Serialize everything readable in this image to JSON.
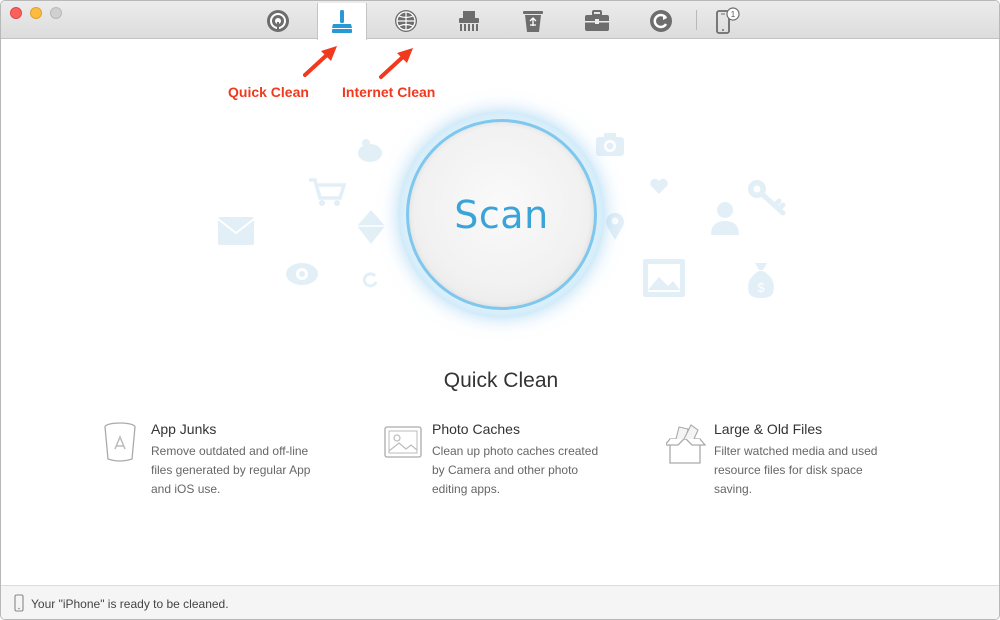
{
  "toolbar": {
    "tools": [
      {
        "name": "airbackup"
      },
      {
        "name": "quick-clean",
        "active": true
      },
      {
        "name": "internet-clean"
      },
      {
        "name": "privacy-clean"
      },
      {
        "name": "junk-clean"
      },
      {
        "name": "toolbox"
      },
      {
        "name": "restore"
      },
      {
        "name": "device",
        "badge": "1"
      }
    ],
    "accent": "#2a97d6"
  },
  "annotations": {
    "quick_clean": "Quick Clean",
    "internet_clean": "Internet Clean",
    "color": "#f0391d"
  },
  "scan": {
    "label": "Scan"
  },
  "section": {
    "title": "Quick Clean"
  },
  "features": [
    {
      "title": "App Junks",
      "description": "Remove outdated and off-line files generated by regular App and iOS use."
    },
    {
      "title": "Photo Caches",
      "description": "Clean up photo caches created by Camera and other photo editing apps."
    },
    {
      "title": "Large & Old Files",
      "description": "Filter watched media and used resource files for disk space saving."
    }
  ],
  "status": {
    "text": "Your \"iPhone\" is ready to be cleaned."
  }
}
